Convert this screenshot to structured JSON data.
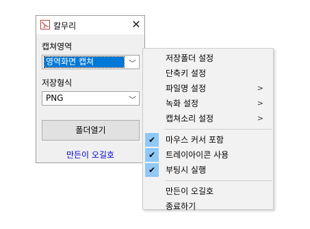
{
  "window": {
    "title": "칼무리",
    "close_glyph": "✕"
  },
  "capture": {
    "label": "캡쳐영역",
    "value": "영역화면 캡쳐"
  },
  "save": {
    "label": "저장형식",
    "value": "PNG"
  },
  "open_folder_button": "폴더열기",
  "author_link": "만든이 오길호",
  "menu": {
    "items": [
      {
        "label": "저장폴더 설정",
        "submenu": false,
        "checked": false
      },
      {
        "label": "단축키 설정",
        "submenu": false,
        "checked": false
      },
      {
        "label": "파일명 설정",
        "submenu": true,
        "checked": false
      },
      {
        "label": "녹화 설정",
        "submenu": true,
        "checked": false
      },
      {
        "label": "캡쳐소리 설정",
        "submenu": true,
        "checked": false
      },
      {
        "label": "마우스 커서 포함",
        "submenu": false,
        "checked": true
      },
      {
        "label": "트레이아이콘 사용",
        "submenu": false,
        "checked": true
      },
      {
        "label": "부팅시 실행",
        "submenu": false,
        "checked": true
      },
      {
        "label": "만든이 오길호",
        "submenu": false,
        "checked": false
      },
      {
        "label": "종료하기",
        "submenu": false,
        "checked": false
      }
    ]
  },
  "colors": {
    "selection": "#0078d7",
    "check_bg": "#90c8f6",
    "link": "#0000cc"
  }
}
